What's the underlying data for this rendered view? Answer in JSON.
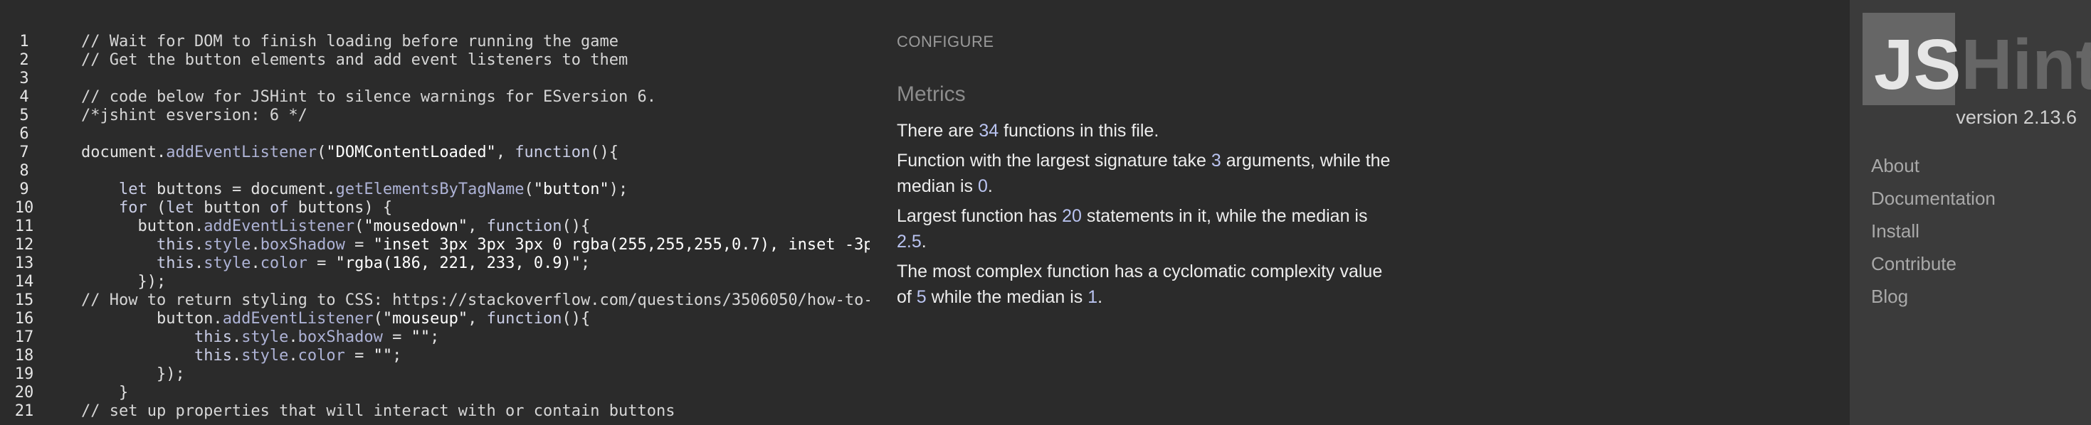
{
  "editor": {
    "lines": [
      {
        "n": "1",
        "tokens": [
          {
            "t": "// Wait for DOM to finish loading before running the game",
            "c": "comment"
          }
        ]
      },
      {
        "n": "2",
        "tokens": [
          {
            "t": "// Get the button elements and add event listeners to them",
            "c": "comment"
          }
        ]
      },
      {
        "n": "3",
        "tokens": []
      },
      {
        "n": "4",
        "tokens": [
          {
            "t": "// code below for JSHint to silence warnings for ESversion 6.",
            "c": "comment"
          }
        ]
      },
      {
        "n": "5",
        "tokens": [
          {
            "t": "/*jshint esversion: 6 */",
            "c": "comment"
          }
        ]
      },
      {
        "n": "6",
        "tokens": []
      },
      {
        "n": "7",
        "tokens": [
          {
            "t": "document.",
            "c": "fn"
          },
          {
            "t": "addEventListener",
            "c": "prop"
          },
          {
            "t": "(",
            "c": "fn"
          },
          {
            "t": "\"DOMContentLoaded\"",
            "c": "str"
          },
          {
            "t": ", ",
            "c": "fn"
          },
          {
            "t": "function",
            "c": "kw"
          },
          {
            "t": "(){",
            "c": "fn"
          }
        ]
      },
      {
        "n": "8",
        "tokens": []
      },
      {
        "n": "9",
        "tokens": [
          {
            "t": "    ",
            "c": "fn"
          },
          {
            "t": "let",
            "c": "kw"
          },
          {
            "t": " buttons = document.",
            "c": "fn"
          },
          {
            "t": "getElementsByTagName",
            "c": "prop"
          },
          {
            "t": "(",
            "c": "fn"
          },
          {
            "t": "\"button\"",
            "c": "str"
          },
          {
            "t": ");",
            "c": "fn"
          }
        ]
      },
      {
        "n": "10",
        "tokens": [
          {
            "t": "    ",
            "c": "fn"
          },
          {
            "t": "for",
            "c": "kw"
          },
          {
            "t": " (",
            "c": "fn"
          },
          {
            "t": "let",
            "c": "kw"
          },
          {
            "t": " button ",
            "c": "fn"
          },
          {
            "t": "of",
            "c": "kw"
          },
          {
            "t": " buttons) {",
            "c": "fn"
          }
        ]
      },
      {
        "n": "11",
        "tokens": [
          {
            "t": "      button.",
            "c": "fn"
          },
          {
            "t": "addEventListener",
            "c": "prop"
          },
          {
            "t": "(",
            "c": "fn"
          },
          {
            "t": "\"mousedown\"",
            "c": "str"
          },
          {
            "t": ", ",
            "c": "fn"
          },
          {
            "t": "function",
            "c": "kw"
          },
          {
            "t": "(){",
            "c": "fn"
          }
        ]
      },
      {
        "n": "12",
        "tokens": [
          {
            "t": "        ",
            "c": "fn"
          },
          {
            "t": "this",
            "c": "kw"
          },
          {
            "t": ".",
            "c": "fn"
          },
          {
            "t": "style",
            "c": "prop"
          },
          {
            "t": ".",
            "c": "fn"
          },
          {
            "t": "boxShadow",
            "c": "prop"
          },
          {
            "t": " = ",
            "c": "fn"
          },
          {
            "t": "\"inset 3px 3px 3px 0 rgba(255,255,255,0.7), inset -3p",
            "c": "str"
          }
        ]
      },
      {
        "n": "13",
        "tokens": [
          {
            "t": "        ",
            "c": "fn"
          },
          {
            "t": "this",
            "c": "kw"
          },
          {
            "t": ".",
            "c": "fn"
          },
          {
            "t": "style",
            "c": "prop"
          },
          {
            "t": ".",
            "c": "fn"
          },
          {
            "t": "color",
            "c": "prop"
          },
          {
            "t": " = ",
            "c": "fn"
          },
          {
            "t": "\"rgba(186, 221, 233, 0.9)\"",
            "c": "str"
          },
          {
            "t": ";",
            "c": "fn"
          }
        ]
      },
      {
        "n": "14",
        "tokens": [
          {
            "t": "      });",
            "c": "fn"
          }
        ]
      },
      {
        "n": "15",
        "tokens": [
          {
            "t": "// How to return styling to CSS: https://stackoverflow.com/questions/3506050/how-to-",
            "c": "comment"
          }
        ]
      },
      {
        "n": "16",
        "tokens": [
          {
            "t": "        button.",
            "c": "fn"
          },
          {
            "t": "addEventListener",
            "c": "prop"
          },
          {
            "t": "(",
            "c": "fn"
          },
          {
            "t": "\"mouseup\"",
            "c": "str"
          },
          {
            "t": ", ",
            "c": "fn"
          },
          {
            "t": "function",
            "c": "kw"
          },
          {
            "t": "(){",
            "c": "fn"
          }
        ]
      },
      {
        "n": "17",
        "tokens": [
          {
            "t": "            ",
            "c": "fn"
          },
          {
            "t": "this",
            "c": "kw"
          },
          {
            "t": ".",
            "c": "fn"
          },
          {
            "t": "style",
            "c": "prop"
          },
          {
            "t": ".",
            "c": "fn"
          },
          {
            "t": "boxShadow",
            "c": "prop"
          },
          {
            "t": " = ",
            "c": "fn"
          },
          {
            "t": "\"\"",
            "c": "str"
          },
          {
            "t": ";",
            "c": "fn"
          }
        ]
      },
      {
        "n": "18",
        "tokens": [
          {
            "t": "            ",
            "c": "fn"
          },
          {
            "t": "this",
            "c": "kw"
          },
          {
            "t": ".",
            "c": "fn"
          },
          {
            "t": "style",
            "c": "prop"
          },
          {
            "t": ".",
            "c": "fn"
          },
          {
            "t": "color",
            "c": "prop"
          },
          {
            "t": " = ",
            "c": "fn"
          },
          {
            "t": "\"\"",
            "c": "str"
          },
          {
            "t": ";",
            "c": "fn"
          }
        ]
      },
      {
        "n": "19",
        "tokens": [
          {
            "t": "        });",
            "c": "fn"
          }
        ]
      },
      {
        "n": "20",
        "tokens": [
          {
            "t": "    }",
            "c": "fn"
          }
        ]
      },
      {
        "n": "21",
        "tokens": [
          {
            "t": "// set up properties that will interact with or contain buttons",
            "c": "comment"
          }
        ]
      }
    ]
  },
  "report": {
    "configure_label": "CONFIGURE",
    "metrics_title": "Metrics",
    "metrics": [
      [
        {
          "t": "There are ",
          "num": false
        },
        {
          "t": "34",
          "num": true
        },
        {
          "t": " functions in this file.",
          "num": false
        }
      ],
      [
        {
          "t": "Function with the largest signature take ",
          "num": false
        },
        {
          "t": "3",
          "num": true
        },
        {
          "t": " arguments, while the median is ",
          "num": false
        },
        {
          "t": "0",
          "num": true
        },
        {
          "t": ".",
          "num": false
        }
      ],
      [
        {
          "t": "Largest function has ",
          "num": false
        },
        {
          "t": "20",
          "num": true
        },
        {
          "t": " statements in it, while the median is ",
          "num": false
        },
        {
          "t": "2.5",
          "num": true
        },
        {
          "t": ".",
          "num": false
        }
      ],
      [
        {
          "t": "The most complex function has a cyclomatic complexity value of ",
          "num": false
        },
        {
          "t": "5",
          "num": true
        },
        {
          "t": " while the median is ",
          "num": false
        },
        {
          "t": "1",
          "num": true
        },
        {
          "t": ".",
          "num": false
        }
      ]
    ]
  },
  "sidebar": {
    "logo_js": "JS",
    "logo_hint": "Hint",
    "version": "version 2.13.6",
    "nav": [
      "About",
      "Documentation",
      "Install",
      "Contribute",
      "Blog"
    ]
  },
  "colors": {
    "background": "#2b2b2b",
    "sidebar_bg": "#3b3b3b",
    "number_accent": "#b9c3f0",
    "nav_text": "#a9a9a9"
  }
}
